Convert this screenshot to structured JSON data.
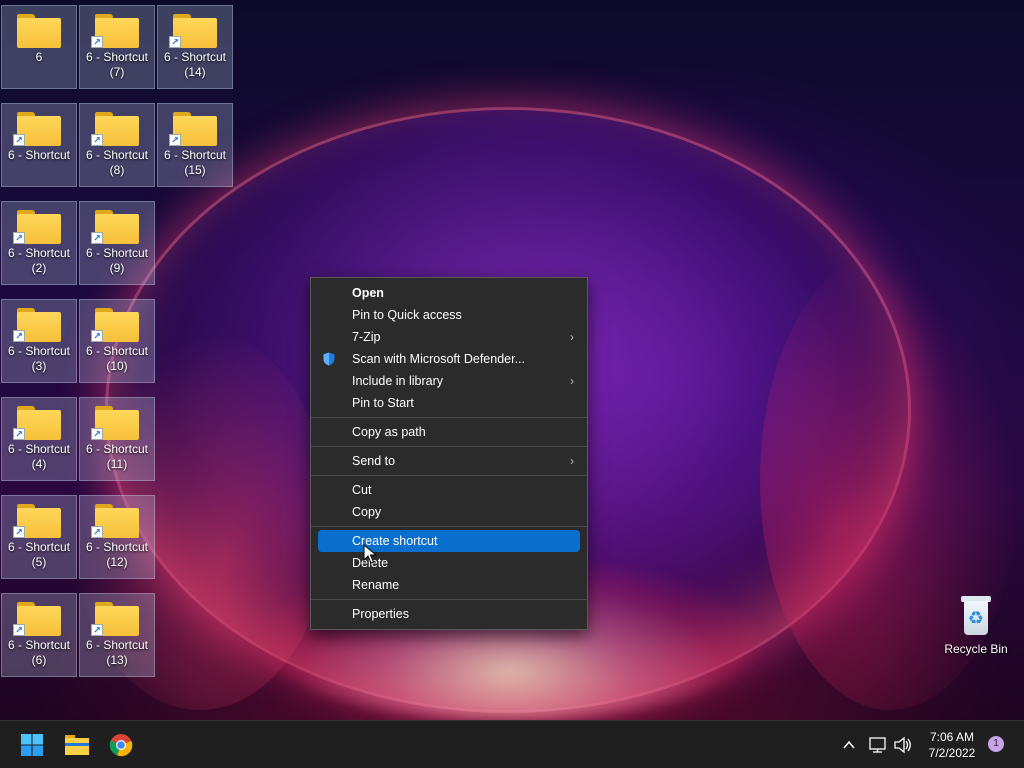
{
  "desktop": {
    "icons": [
      {
        "label": "6",
        "shortcut": false
      },
      {
        "label": "6 - Shortcut",
        "shortcut": true
      },
      {
        "label": "6 - Shortcut\n(2)",
        "shortcut": true
      },
      {
        "label": "6 - Shortcut\n(3)",
        "shortcut": true
      },
      {
        "label": "6 - Shortcut\n(4)",
        "shortcut": true
      },
      {
        "label": "6 - Shortcut\n(5)",
        "shortcut": true
      },
      {
        "label": "6 - Shortcut\n(6)",
        "shortcut": true
      },
      {
        "label": "6 - Shortcut\n(7)",
        "shortcut": true
      },
      {
        "label": "6 - Shortcut\n(8)",
        "shortcut": true
      },
      {
        "label": "6 - Shortcut\n(9)",
        "shortcut": true
      },
      {
        "label": "6 - Shortcut\n(10)",
        "shortcut": true
      },
      {
        "label": "6 - Shortcut\n(11)",
        "shortcut": true
      },
      {
        "label": "6 - Shortcut\n(12)",
        "shortcut": true
      },
      {
        "label": "6 - Shortcut\n(13)",
        "shortcut": true
      },
      {
        "label": "6 - Shortcut\n(14)",
        "shortcut": true
      },
      {
        "label": "6 - Shortcut\n(15)",
        "shortcut": true
      }
    ],
    "recycle_bin": {
      "label": "Recycle Bin",
      "icon": "recycle-bin-icon"
    }
  },
  "context_menu": {
    "open": "Open",
    "pin_quick_access": "Pin to Quick access",
    "seven_zip": "7-Zip",
    "scan_defender": "Scan with Microsoft Defender...",
    "include_library": "Include in library",
    "pin_start": "Pin to Start",
    "copy_as_path": "Copy as path",
    "send_to": "Send to",
    "cut": "Cut",
    "copy": "Copy",
    "create_shortcut": "Create shortcut",
    "delete": "Delete",
    "rename": "Rename",
    "properties": "Properties",
    "highlighted_item": "create_shortcut",
    "submenu_icon": "chevron-right-icon",
    "defender_icon": "shield-icon"
  },
  "taskbar": {
    "apps": [
      {
        "name": "start-button",
        "icon": "windows-logo-icon"
      },
      {
        "name": "file-explorer",
        "icon": "folder-icon"
      },
      {
        "name": "chrome",
        "icon": "chrome-icon"
      }
    ],
    "tray": {
      "time": "7:06 AM",
      "date": "7/2/2022",
      "notification_count": "1"
    },
    "colors": {
      "background": "#1f1f1f",
      "accent": "#0a6fcc"
    }
  }
}
